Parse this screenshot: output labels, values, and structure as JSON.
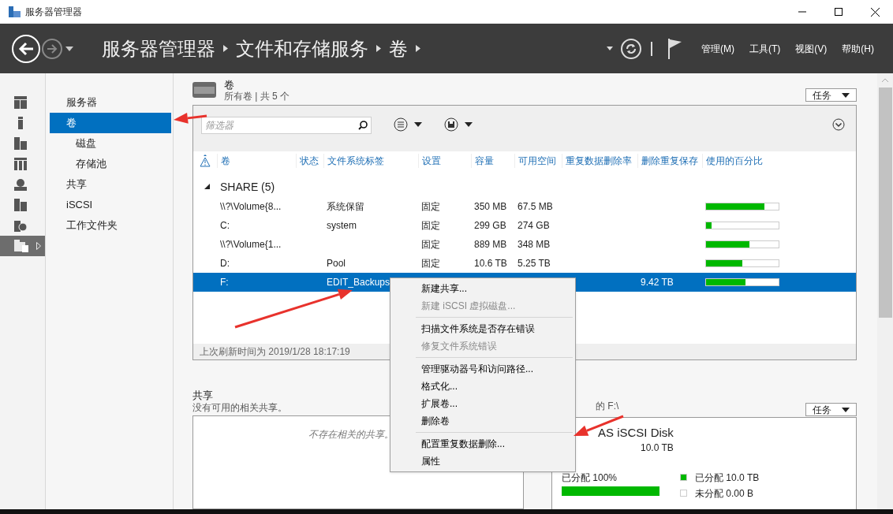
{
  "window": {
    "title": "服务器管理器"
  },
  "breadcrumb": [
    "服务器管理器",
    "文件和存储服务",
    "卷"
  ],
  "menu_bar": [
    "管理(M)",
    "工具(T)",
    "视图(V)",
    "帮助(H)"
  ],
  "icon_strip": [
    {
      "kind": "dashboard",
      "selected": false
    },
    {
      "kind": "server",
      "selected": false
    },
    {
      "kind": "servers",
      "selected": false
    },
    {
      "kind": "group",
      "selected": false
    },
    {
      "kind": "network",
      "selected": false
    },
    {
      "kind": "building",
      "selected": false
    },
    {
      "kind": "roles",
      "selected": false
    },
    {
      "kind": "storage",
      "selected": true
    }
  ],
  "nav": [
    {
      "label": "服务器",
      "selected": false
    },
    {
      "label": "卷",
      "selected": true,
      "children": [
        {
          "label": "磁盘",
          "selected": false
        },
        {
          "label": "存储池",
          "selected": false
        }
      ]
    },
    {
      "label": "共享",
      "selected": false
    },
    {
      "label": "iSCSI",
      "selected": false
    },
    {
      "label": "工作文件夹",
      "selected": false
    }
  ],
  "volumes": {
    "title": "卷",
    "subtitle": "所有卷 | 共 5 个",
    "tasks": "任务",
    "filter_placeholder": "筛选器",
    "columns": [
      "卷",
      "状态",
      "文件系统标签",
      "设置",
      "容量",
      "可用空间",
      "重复数据删除率",
      "删除重复保存",
      "使用的百分比"
    ],
    "group": {
      "label": "SHARE (5)",
      "expanded": true
    },
    "rows": [
      {
        "volume": "\\\\?\\Volume{8...",
        "label": "系统保留",
        "setting": "固定",
        "capacity": "350 MB",
        "free": "67.5 MB",
        "savings": "",
        "level": 0.8,
        "selected": false
      },
      {
        "volume": "C:",
        "label": "system",
        "setting": "固定",
        "capacity": "299 GB",
        "free": "274 GB",
        "savings": "",
        "level": 0.08,
        "selected": false
      },
      {
        "volume": "\\\\?\\Volume{1...",
        "label": "",
        "setting": "固定",
        "capacity": "889 MB",
        "free": "348 MB",
        "savings": "",
        "level": 0.6,
        "selected": false
      },
      {
        "volume": "D:",
        "label": "Pool",
        "setting": "固定",
        "capacity": "10.6 TB",
        "free": "5.25 TB",
        "savings": "",
        "level": 0.5,
        "selected": false
      },
      {
        "volume": "F:",
        "label": "EDIT_Backups",
        "setting": "",
        "capacity": "",
        "free": "",
        "savings": "9.42 TB",
        "level": 0.54,
        "selected": true
      }
    ],
    "footer": "上次刷新时间为 2019/1/28 18:17:19"
  },
  "shares": {
    "title": "共享",
    "subtitle": "没有可用的相关共享。",
    "empty": "不存在相关的共享。"
  },
  "disk": {
    "title": "的 F:\\",
    "tasks": "任务",
    "name": "AS iSCSI Disk",
    "size": "10.0 TB",
    "allocated_label": "已分配 100%",
    "level": 1,
    "legend": [
      {
        "label": "已分配 10.0 TB",
        "color": "#00b800"
      },
      {
        "label": "未分配 0.00 B",
        "color": "#ffffff"
      }
    ]
  },
  "context_menu": {
    "groups": [
      {
        "items": [
          {
            "label": "新建共享...",
            "disabled": false
          },
          {
            "label": "新建 iSCSI 虚拟磁盘...",
            "disabled": true
          }
        ]
      },
      {
        "items": [
          {
            "label": "扫描文件系统是否存在错误",
            "disabled": false
          },
          {
            "label": "修复文件系统错误",
            "disabled": true
          }
        ]
      },
      {
        "items": [
          {
            "label": "管理驱动器号和访问路径...",
            "disabled": false
          },
          {
            "label": "格式化...",
            "disabled": false
          },
          {
            "label": "扩展卷...",
            "disabled": false
          },
          {
            "label": "删除卷",
            "disabled": false
          }
        ]
      },
      {
        "items": [
          {
            "label": "配置重复数据删除...",
            "disabled": false
          },
          {
            "label": "属性",
            "disabled": false
          }
        ]
      }
    ]
  }
}
